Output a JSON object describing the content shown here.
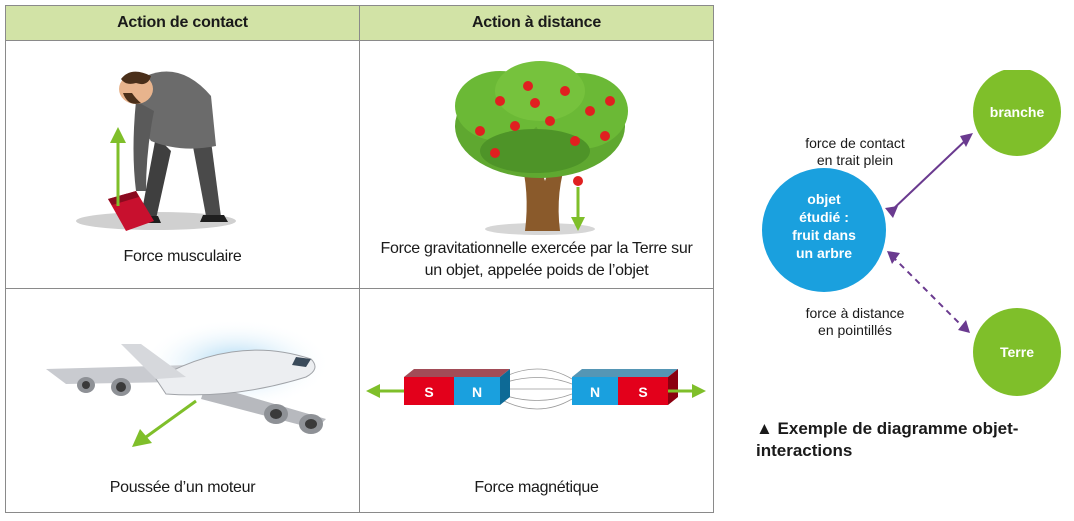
{
  "table": {
    "headers": [
      "Action de contact",
      "Action à distance"
    ],
    "cells": [
      {
        "caption_lines": [
          "Force musculaire"
        ],
        "illustration": "man-lifting-box"
      },
      {
        "caption_lines": [
          "Force gravitationnelle exercée par la Terre sur",
          "un objet, appelée poids de l’objet"
        ],
        "illustration": "apple-tree"
      },
      {
        "caption_lines": [
          "Poussée d’un moteur"
        ],
        "illustration": "airplane"
      },
      {
        "caption_lines": [
          "Force magnétique"
        ],
        "illustration": "magnets"
      }
    ],
    "magnet_letters": [
      "S",
      "N",
      "N",
      "S"
    ]
  },
  "diagram": {
    "nodes": {
      "center": [
        "objet",
        "étudié :",
        "fruit dans",
        "un arbre"
      ],
      "branche": "branche",
      "terre": "Terre"
    },
    "labels": {
      "contact": [
        "force de contact",
        "en trait plein"
      ],
      "distance": [
        "force à distance",
        "en pointillés"
      ]
    },
    "colors": {
      "green": "#7fbf2a",
      "blue": "#1aa0de",
      "arrow": "#6a3a8f"
    },
    "caption_lines": [
      "▲ Exemple de diagramme objet-",
      "interactions"
    ]
  }
}
